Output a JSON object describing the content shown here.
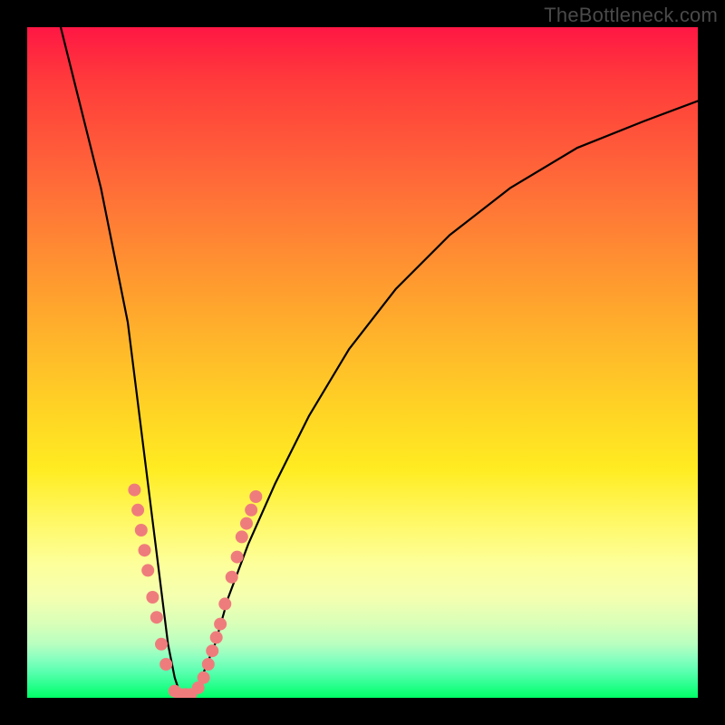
{
  "watermark": "TheBottleneck.com",
  "chart_data": {
    "type": "line",
    "title": "",
    "xlabel": "",
    "ylabel": "",
    "xlim": [
      0,
      100
    ],
    "ylim": [
      0,
      100
    ],
    "series": [
      {
        "name": "bottleneck-curve",
        "x": [
          5,
          8,
          11,
          13,
          15,
          16,
          17,
          18,
          19,
          20,
          21,
          22,
          23,
          24,
          25,
          26,
          28,
          30,
          33,
          37,
          42,
          48,
          55,
          63,
          72,
          82,
          92,
          100
        ],
        "y": [
          100,
          88,
          76,
          66,
          56,
          48,
          40,
          32,
          24,
          16,
          8,
          3,
          0,
          0,
          1,
          3,
          8,
          15,
          23,
          32,
          42,
          52,
          61,
          69,
          76,
          82,
          86,
          89
        ]
      }
    ],
    "markers": {
      "name": "highlight-dots",
      "color": "#ef7c7c",
      "points": [
        {
          "x": 16.0,
          "y": 31
        },
        {
          "x": 16.5,
          "y": 28
        },
        {
          "x": 17.0,
          "y": 25
        },
        {
          "x": 17.5,
          "y": 22
        },
        {
          "x": 18.0,
          "y": 19
        },
        {
          "x": 18.7,
          "y": 15
        },
        {
          "x": 19.3,
          "y": 12
        },
        {
          "x": 20.0,
          "y": 8
        },
        {
          "x": 20.7,
          "y": 5
        },
        {
          "x": 22.0,
          "y": 1
        },
        {
          "x": 22.8,
          "y": 0.5
        },
        {
          "x": 23.6,
          "y": 0.5
        },
        {
          "x": 24.4,
          "y": 0.5
        },
        {
          "x": 25.5,
          "y": 1.5
        },
        {
          "x": 26.3,
          "y": 3
        },
        {
          "x": 27.0,
          "y": 5
        },
        {
          "x": 27.6,
          "y": 7
        },
        {
          "x": 28.2,
          "y": 9
        },
        {
          "x": 28.8,
          "y": 11
        },
        {
          "x": 29.5,
          "y": 14
        },
        {
          "x": 30.5,
          "y": 18
        },
        {
          "x": 31.3,
          "y": 21
        },
        {
          "x": 32.0,
          "y": 24
        },
        {
          "x": 32.7,
          "y": 26
        },
        {
          "x": 33.4,
          "y": 28
        },
        {
          "x": 34.1,
          "y": 30
        }
      ]
    }
  }
}
